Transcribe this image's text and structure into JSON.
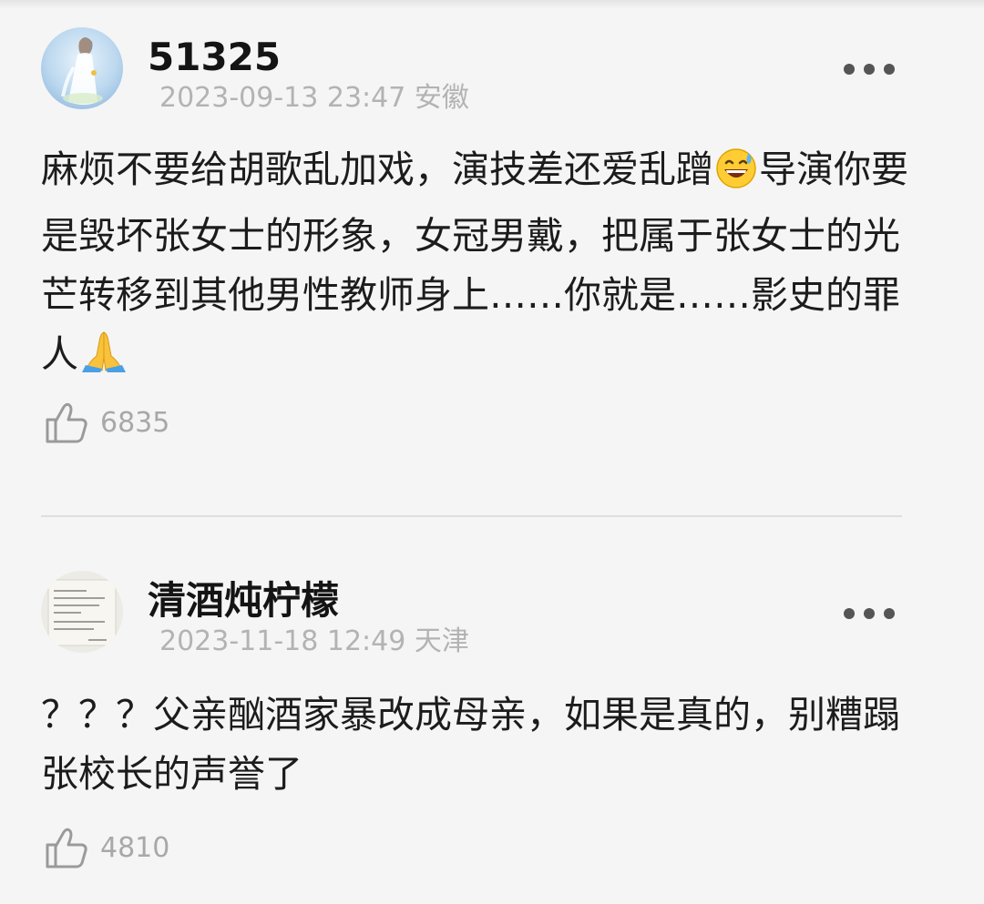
{
  "comments": [
    {
      "username": "51325",
      "timestamp": "2023-09-13 23:47",
      "location": "安徽",
      "text_parts": [
        "麻烦不要给胡歌乱加戏，演技差还爱乱蹭",
        "导演你要是毁坏张女士的形象，女冠男戴，把属于张女士的光芒转移到其他男性教师身上……你就是……影史的罪人"
      ],
      "emojis": [
        "grinning-sweat-emoji",
        "folded-hands-emoji"
      ],
      "likes": "6835",
      "avatar": "avatar-woman-white-dress"
    },
    {
      "username": "清酒炖柠檬",
      "timestamp": "2023-11-18 12:49",
      "location": "天津",
      "text": "？？？父亲酗酒家暴改成母亲，如果是真的，别糟蹋张校长的声誉了",
      "likes": "4810",
      "avatar": "avatar-handwritten-notes"
    }
  ],
  "icons": {
    "more": "more-options-icon",
    "like": "thumbs-up-icon"
  },
  "colors": {
    "background": "#f5f5f5",
    "username": "#141414",
    "meta": "#b3b3b3",
    "body_text": "#1c1c1c",
    "like_count": "#a8a8a8",
    "divider": "#dedede"
  }
}
